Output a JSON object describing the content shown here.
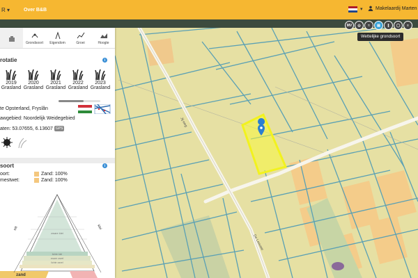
{
  "topbar": {
    "brand": "R ▾",
    "nav_item": "Over B&B",
    "user_name": "Makelaardij Marten"
  },
  "tools": [
    {
      "label": "MV",
      "icon": "mv-icon"
    },
    {
      "label": "",
      "icon": "layer-icon"
    },
    {
      "label": "",
      "icon": "soil-icon"
    },
    {
      "label": "",
      "icon": "legal-soil-icon",
      "active": true
    },
    {
      "label": "",
      "icon": "columns-icon"
    },
    {
      "label": "",
      "icon": "circle-icon"
    },
    {
      "label": "",
      "icon": "menu-icon"
    }
  ],
  "tooltip": "Wettelijke grondsoort",
  "panel": {
    "tabs": [
      {
        "label": "",
        "icon": "hand-icon"
      },
      {
        "label": "Grondsoort",
        "icon": "soil-tab-icon"
      },
      {
        "label": "Eigendom",
        "icon": "ownership-icon"
      },
      {
        "label": "Groei",
        "icon": "growth-icon"
      },
      {
        "label": "Hoogte",
        "icon": "height-icon"
      }
    ],
    "rotation_title": "rotatie",
    "years": [
      {
        "year": "2019",
        "crop": "Grasland"
      },
      {
        "year": "2020",
        "crop": "Grasland"
      },
      {
        "year": "2021",
        "crop": "Grasland"
      },
      {
        "year": "2022",
        "crop": "Grasland"
      },
      {
        "year": "2023",
        "crop": "Grasland"
      }
    ],
    "location": "te Opsterland, Fryslân",
    "area": "awgebied: Noordelijk Weidegebied",
    "coords": "aten: 53.07655, 6.13607",
    "coords_badge": "GPS",
    "soil_title": "soort",
    "soil_rows": [
      {
        "label": "oort:",
        "value": "Zand: 100%"
      },
      {
        "label": "mestwet:",
        "value": "Zand: 100%"
      }
    ],
    "triangle": {
      "left_label": "silt",
      "right_label": "klei",
      "layers": [
        "zware klei",
        "lichte klei",
        "zware zavel",
        "lichte zavel"
      ],
      "bottom_left": "zand"
    }
  },
  "map": {
    "road_labels": [
      "Jij weg",
      "De Leeuwe"
    ]
  },
  "colors": {
    "topbar": "#f6b731",
    "parcel": "#e8e3a0",
    "ditch": "#5a9fb5",
    "selection": "#f7f73c",
    "pin": "#2c7fd0"
  }
}
